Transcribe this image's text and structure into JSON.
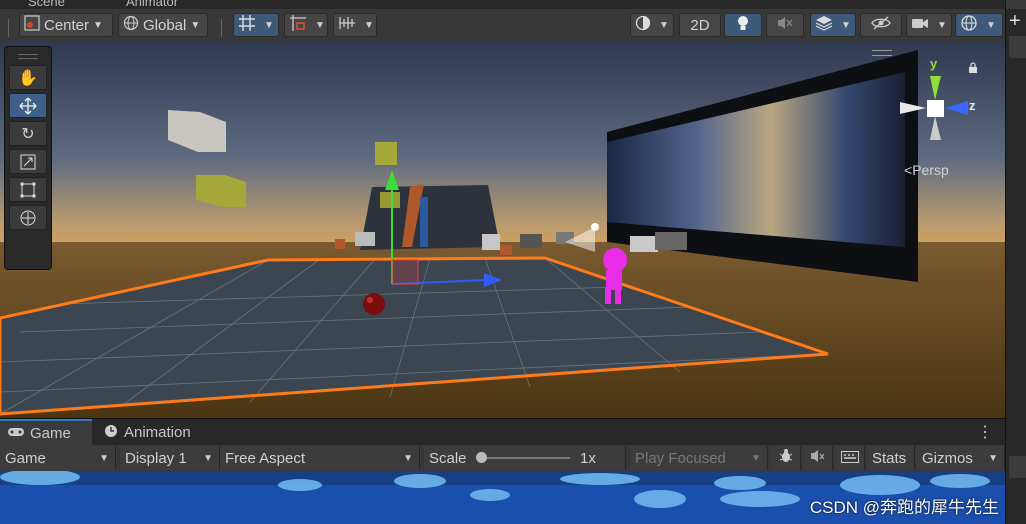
{
  "tabs": {
    "scene": "Scene",
    "animator": "Animator"
  },
  "toolbar": {
    "pivot": "Center",
    "space": "Global",
    "mode_2d": "2D"
  },
  "gizmo": {
    "y": "y",
    "z": "z",
    "projection": "Persp"
  },
  "game": {
    "tab_game": "Game",
    "tab_animation": "Animation",
    "mode": "Game",
    "display": "Display 1",
    "aspect": "Free Aspect",
    "scale_label": "Scale",
    "scale_value": "1x",
    "scale_fraction": 0.0,
    "play_mode": "Play Focused",
    "stats": "Stats",
    "gizmos": "Gizmos",
    "more": "⋮"
  },
  "watermark": "CSDN @奔跑的犀牛先生",
  "icons": [
    "hand-icon",
    "move-icon",
    "rotate-icon",
    "scale-icon",
    "rect-icon",
    "transform-icon",
    "light-icon",
    "audio-mute-icon",
    "effects-icon",
    "visibility-icon",
    "camera-icon",
    "gizmo-icon",
    "bug-icon",
    "grid-icon"
  ]
}
